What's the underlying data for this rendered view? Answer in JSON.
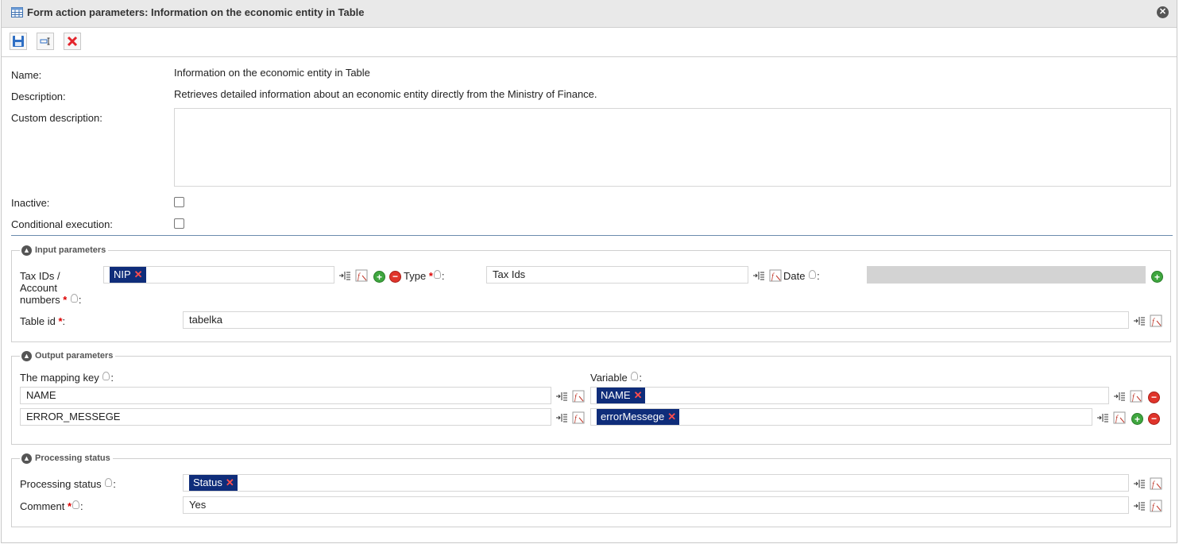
{
  "title": "Form action parameters: Information on the economic entity in Table",
  "toolbar": {
    "icons": [
      "save-icon",
      "rename-field-icon",
      "delete-icon"
    ]
  },
  "form": {
    "name_label": "Name:",
    "name_value": "Information on the economic entity in Table",
    "description_label": "Description:",
    "description_value": "Retrieves detailed information about an economic entity directly from the Ministry of Finance.",
    "custom_description_label": "Custom description:",
    "custom_description_value": "",
    "inactive_label": "Inactive:",
    "inactive_checked": false,
    "conditional_label": "Conditional execution:",
    "conditional_checked": false
  },
  "input_params": {
    "legend": "Input parameters",
    "tax_ids_label_line1": "Tax IDs /",
    "tax_ids_label_line2": "Account",
    "tax_ids_label_line3": "numbers",
    "tax_ids_tag": "NIP",
    "type_label": "Type",
    "type_value": "Tax Ids",
    "date_label": "Date",
    "date_value": "",
    "table_id_label": "Table id",
    "table_id_value": "tabelka"
  },
  "output_params": {
    "legend": "Output parameters",
    "mapping_key_label": "The mapping key",
    "variable_label": "Variable",
    "rows": [
      {
        "key": "NAME",
        "variable": "NAME"
      },
      {
        "key": "ERROR_MESSEGE",
        "variable": "errorMessege"
      }
    ]
  },
  "processing": {
    "legend": "Processing status",
    "status_label": "Processing status",
    "status_tag": "Status",
    "comment_label": "Comment",
    "comment_value": "Yes"
  },
  "colors": {
    "tag_bg": "#0f2d7a",
    "required": "#dd0000",
    "divider": "#6b8cae"
  }
}
